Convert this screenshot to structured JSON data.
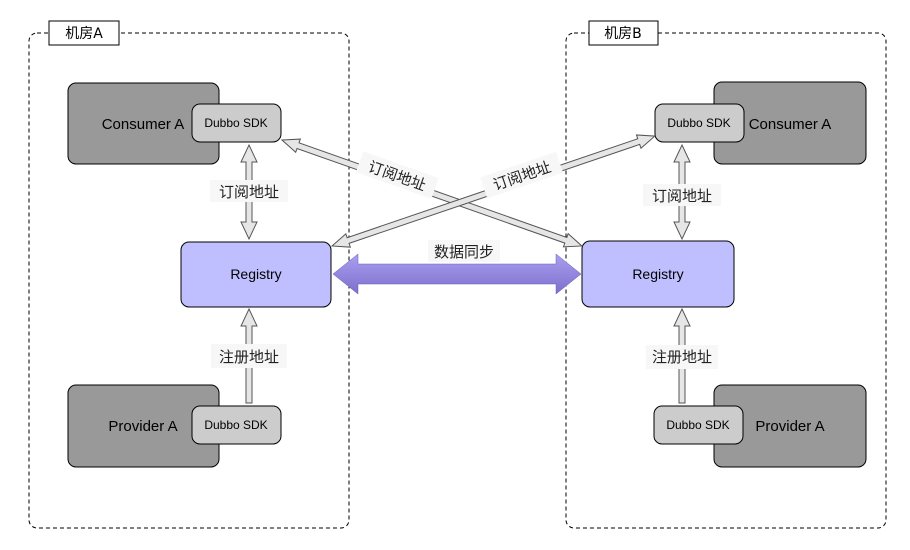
{
  "diagram": {
    "rooms": [
      {
        "label": "机房A",
        "consumer": "Consumer A",
        "provider": "Provider A",
        "sdk": "Dubbo SDK",
        "registry": "Registry",
        "subscribe_label": "订阅地址",
        "register_label": "注册地址"
      },
      {
        "label": "机房B",
        "consumer": "Consumer A",
        "provider": "Provider A",
        "sdk": "Dubbo SDK",
        "registry": "Registry",
        "subscribe_label": "订阅地址",
        "register_label": "注册地址"
      }
    ],
    "cross_labels": [
      "订阅地址",
      "订阅地址"
    ],
    "sync_label": "数据同步",
    "colors": {
      "app_box": "#999999",
      "sdk_box": "#cccccc",
      "registry_box": "#bfbfff",
      "arrow_fill": "#e6e6e6",
      "sync_arrow": "#8b7fd6",
      "border": "#000000"
    }
  }
}
